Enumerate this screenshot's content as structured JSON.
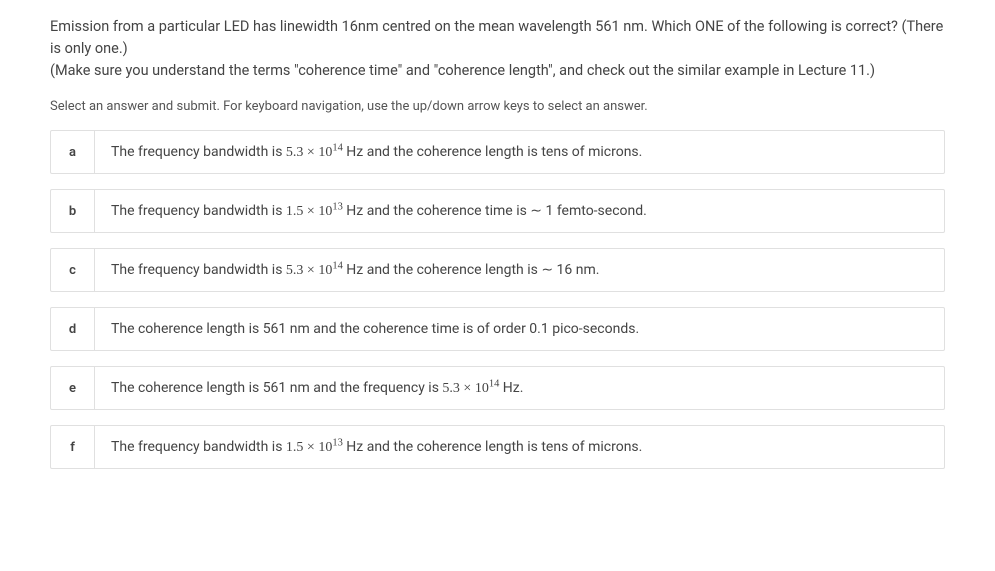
{
  "question": {
    "line1": "Emission from a particular LED has linewidth 16nm centred on the mean wavelength 561 nm. Which ONE of the following is correct? (There is only one.)",
    "line2": "(Make sure you understand the terms \"coherence time\" and \"coherence length\", and check out the similar example in Lecture 11.)"
  },
  "instruction": "Select an answer and submit. For keyboard navigation, use the up/down arrow keys to select an answer.",
  "options": [
    {
      "key": "a",
      "text_before": "The frequency bandwidth is ",
      "math": "5.3 × 10<sup>14</sup>",
      "text_after": " Hz and the coherence length is tens of microns."
    },
    {
      "key": "b",
      "text_before": "The frequency bandwidth is ",
      "math": "1.5 × 10<sup>13</sup>",
      "text_after": " Hz and the coherence time is ∼  1 femto-second."
    },
    {
      "key": "c",
      "text_before": "The frequency bandwidth is ",
      "math": "5.3 × 10<sup>14</sup>",
      "text_after": " Hz and the coherence length is ∼ 16 nm."
    },
    {
      "key": "d",
      "text_before": "The coherence length is 561 nm and the coherence time is of order 0.1 pico-seconds.",
      "math": "",
      "text_after": ""
    },
    {
      "key": "e",
      "text_before": "The coherence length is 561 nm and the frequency is ",
      "math": "5.3 × 10<sup>14</sup>",
      "text_after": " Hz."
    },
    {
      "key": "f",
      "text_before": "The frequency bandwidth is ",
      "math": "1.5 × 10<sup>13</sup>",
      "text_after": " Hz and the coherence length is tens of microns."
    }
  ]
}
